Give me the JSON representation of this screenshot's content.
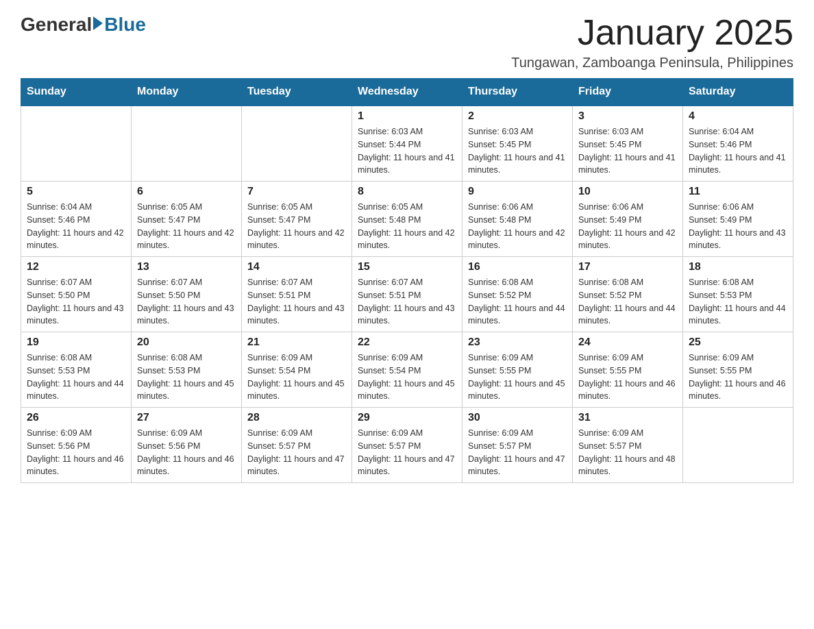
{
  "header": {
    "logo_general": "General",
    "logo_blue": "Blue",
    "month_year": "January 2025",
    "location": "Tungawan, Zamboanga Peninsula, Philippines"
  },
  "days_of_week": [
    "Sunday",
    "Monday",
    "Tuesday",
    "Wednesday",
    "Thursday",
    "Friday",
    "Saturday"
  ],
  "weeks": [
    [
      {
        "day": "",
        "info": ""
      },
      {
        "day": "",
        "info": ""
      },
      {
        "day": "",
        "info": ""
      },
      {
        "day": "1",
        "info": "Sunrise: 6:03 AM\nSunset: 5:44 PM\nDaylight: 11 hours and 41 minutes."
      },
      {
        "day": "2",
        "info": "Sunrise: 6:03 AM\nSunset: 5:45 PM\nDaylight: 11 hours and 41 minutes."
      },
      {
        "day": "3",
        "info": "Sunrise: 6:03 AM\nSunset: 5:45 PM\nDaylight: 11 hours and 41 minutes."
      },
      {
        "day": "4",
        "info": "Sunrise: 6:04 AM\nSunset: 5:46 PM\nDaylight: 11 hours and 41 minutes."
      }
    ],
    [
      {
        "day": "5",
        "info": "Sunrise: 6:04 AM\nSunset: 5:46 PM\nDaylight: 11 hours and 42 minutes."
      },
      {
        "day": "6",
        "info": "Sunrise: 6:05 AM\nSunset: 5:47 PM\nDaylight: 11 hours and 42 minutes."
      },
      {
        "day": "7",
        "info": "Sunrise: 6:05 AM\nSunset: 5:47 PM\nDaylight: 11 hours and 42 minutes."
      },
      {
        "day": "8",
        "info": "Sunrise: 6:05 AM\nSunset: 5:48 PM\nDaylight: 11 hours and 42 minutes."
      },
      {
        "day": "9",
        "info": "Sunrise: 6:06 AM\nSunset: 5:48 PM\nDaylight: 11 hours and 42 minutes."
      },
      {
        "day": "10",
        "info": "Sunrise: 6:06 AM\nSunset: 5:49 PM\nDaylight: 11 hours and 42 minutes."
      },
      {
        "day": "11",
        "info": "Sunrise: 6:06 AM\nSunset: 5:49 PM\nDaylight: 11 hours and 43 minutes."
      }
    ],
    [
      {
        "day": "12",
        "info": "Sunrise: 6:07 AM\nSunset: 5:50 PM\nDaylight: 11 hours and 43 minutes."
      },
      {
        "day": "13",
        "info": "Sunrise: 6:07 AM\nSunset: 5:50 PM\nDaylight: 11 hours and 43 minutes."
      },
      {
        "day": "14",
        "info": "Sunrise: 6:07 AM\nSunset: 5:51 PM\nDaylight: 11 hours and 43 minutes."
      },
      {
        "day": "15",
        "info": "Sunrise: 6:07 AM\nSunset: 5:51 PM\nDaylight: 11 hours and 43 minutes."
      },
      {
        "day": "16",
        "info": "Sunrise: 6:08 AM\nSunset: 5:52 PM\nDaylight: 11 hours and 44 minutes."
      },
      {
        "day": "17",
        "info": "Sunrise: 6:08 AM\nSunset: 5:52 PM\nDaylight: 11 hours and 44 minutes."
      },
      {
        "day": "18",
        "info": "Sunrise: 6:08 AM\nSunset: 5:53 PM\nDaylight: 11 hours and 44 minutes."
      }
    ],
    [
      {
        "day": "19",
        "info": "Sunrise: 6:08 AM\nSunset: 5:53 PM\nDaylight: 11 hours and 44 minutes."
      },
      {
        "day": "20",
        "info": "Sunrise: 6:08 AM\nSunset: 5:53 PM\nDaylight: 11 hours and 45 minutes."
      },
      {
        "day": "21",
        "info": "Sunrise: 6:09 AM\nSunset: 5:54 PM\nDaylight: 11 hours and 45 minutes."
      },
      {
        "day": "22",
        "info": "Sunrise: 6:09 AM\nSunset: 5:54 PM\nDaylight: 11 hours and 45 minutes."
      },
      {
        "day": "23",
        "info": "Sunrise: 6:09 AM\nSunset: 5:55 PM\nDaylight: 11 hours and 45 minutes."
      },
      {
        "day": "24",
        "info": "Sunrise: 6:09 AM\nSunset: 5:55 PM\nDaylight: 11 hours and 46 minutes."
      },
      {
        "day": "25",
        "info": "Sunrise: 6:09 AM\nSunset: 5:55 PM\nDaylight: 11 hours and 46 minutes."
      }
    ],
    [
      {
        "day": "26",
        "info": "Sunrise: 6:09 AM\nSunset: 5:56 PM\nDaylight: 11 hours and 46 minutes."
      },
      {
        "day": "27",
        "info": "Sunrise: 6:09 AM\nSunset: 5:56 PM\nDaylight: 11 hours and 46 minutes."
      },
      {
        "day": "28",
        "info": "Sunrise: 6:09 AM\nSunset: 5:57 PM\nDaylight: 11 hours and 47 minutes."
      },
      {
        "day": "29",
        "info": "Sunrise: 6:09 AM\nSunset: 5:57 PM\nDaylight: 11 hours and 47 minutes."
      },
      {
        "day": "30",
        "info": "Sunrise: 6:09 AM\nSunset: 5:57 PM\nDaylight: 11 hours and 47 minutes."
      },
      {
        "day": "31",
        "info": "Sunrise: 6:09 AM\nSunset: 5:57 PM\nDaylight: 11 hours and 48 minutes."
      },
      {
        "day": "",
        "info": ""
      }
    ]
  ]
}
